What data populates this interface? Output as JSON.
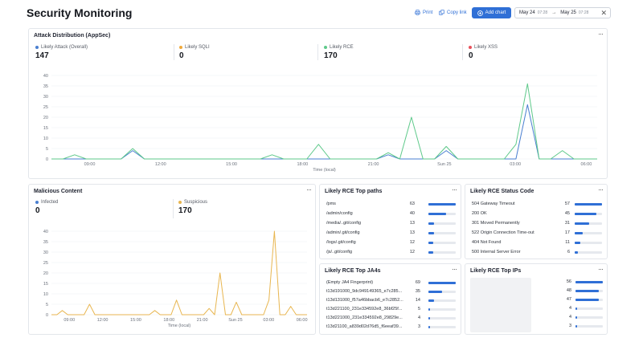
{
  "header": {
    "title": "Security Monitoring",
    "print_label": "Print",
    "copy_link_label": "Copy link",
    "add_chart_label": "Add chart",
    "date_from": "May 24",
    "time_from": "07:28",
    "date_to": "May 25",
    "time_to": "07:28",
    "arrow": "→",
    "close": "✕"
  },
  "colors": {
    "accent": "#2f6fd6",
    "attack": "#4a7fd0",
    "sqli": "#f0a93b",
    "rce": "#5ec98a",
    "xss": "#e8505b",
    "infected": "#4a7fd0",
    "suspicious": "#e8b650"
  },
  "attack_panel": {
    "title": "Attack Distribution (AppSec)",
    "menu": "···",
    "metrics": [
      {
        "label": "Likely Attack (Overall)",
        "value": "147",
        "color": "#4a7fd0"
      },
      {
        "label": "Likely SQLI",
        "value": "0",
        "color": "#f0a93b"
      },
      {
        "label": "Likely RCE",
        "value": "170",
        "color": "#5ec98a"
      },
      {
        "label": "Likely XSS",
        "value": "0",
        "color": "#e8505b"
      }
    ]
  },
  "malicious_panel": {
    "title": "Malicious Content",
    "menu": "···",
    "metrics": [
      {
        "label": "Infected",
        "value": "0",
        "color": "#4a7fd0"
      },
      {
        "label": "Suspicious",
        "value": "170",
        "color": "#e8b650"
      }
    ]
  },
  "chart_data": [
    {
      "type": "line",
      "panel": "Attack Distribution (AppSec)",
      "xlabel": "Time (local)",
      "ylabel": "",
      "ylim": [
        0,
        40
      ],
      "yticks": [
        "0",
        "5",
        "10",
        "15",
        "20",
        "25",
        "30",
        "35",
        "40"
      ],
      "xticks": [
        "09:00",
        "12:00",
        "15:00",
        "18:00",
        "21:00",
        "Sun 25",
        "03:00",
        "06:00"
      ],
      "x": [
        0,
        1,
        2,
        3,
        4,
        5,
        6,
        7,
        8,
        9,
        10,
        11,
        12,
        13,
        14,
        15,
        16,
        17,
        18,
        19,
        20,
        21,
        22,
        23,
        24,
        25,
        26,
        27,
        28,
        29,
        30,
        31,
        32,
        33,
        34,
        35,
        36,
        37,
        38,
        39,
        40,
        41,
        42,
        43,
        44,
        45,
        46,
        47
      ],
      "series": [
        {
          "name": "Likely Attack (Overall)",
          "color": "#4a7fd0",
          "values": [
            0,
            0,
            0,
            0,
            0,
            0,
            0,
            4,
            0,
            0,
            0,
            0,
            0,
            0,
            0,
            0,
            0,
            0,
            0,
            0,
            0,
            0,
            0,
            0,
            0,
            0,
            0,
            0,
            0,
            2,
            0,
            0,
            0,
            0,
            4,
            0,
            0,
            0,
            0,
            0,
            0,
            26,
            0,
            0,
            0,
            0,
            0,
            0
          ]
        },
        {
          "name": "Likely RCE",
          "color": "#5ec98a",
          "values": [
            0,
            0,
            2,
            0,
            0,
            0,
            0,
            5,
            0,
            0,
            0,
            0,
            0,
            0,
            0,
            0,
            0,
            0,
            0,
            2,
            0,
            0,
            0,
            7,
            0,
            0,
            0,
            0,
            0,
            3,
            0,
            20,
            0,
            0,
            6,
            0,
            0,
            0,
            0,
            0,
            7,
            36,
            0,
            0,
            4,
            0,
            0,
            0
          ]
        }
      ]
    },
    {
      "type": "line",
      "panel": "Malicious Content",
      "xlabel": "Time (local)",
      "ylabel": "",
      "ylim": [
        0,
        40
      ],
      "yticks": [
        "0",
        "5",
        "10",
        "15",
        "20",
        "25",
        "30",
        "35",
        "40"
      ],
      "xticks": [
        "09:00",
        "12:00",
        "15:00",
        "18:00",
        "21:00",
        "Sun 25",
        "03:00",
        "06:00"
      ],
      "x": [
        0,
        1,
        2,
        3,
        4,
        5,
        6,
        7,
        8,
        9,
        10,
        11,
        12,
        13,
        14,
        15,
        16,
        17,
        18,
        19,
        20,
        21,
        22,
        23,
        24,
        25,
        26,
        27,
        28,
        29,
        30,
        31,
        32,
        33,
        34,
        35,
        36,
        37,
        38,
        39,
        40,
        41,
        42,
        43,
        44,
        45,
        46,
        47
      ],
      "series": [
        {
          "name": "Suspicious",
          "color": "#e8b650",
          "values": [
            0,
            0,
            2,
            0,
            0,
            0,
            0,
            5,
            0,
            0,
            0,
            0,
            0,
            0,
            0,
            0,
            0,
            0,
            0,
            2,
            0,
            0,
            0,
            7,
            0,
            0,
            0,
            0,
            0,
            3,
            0,
            20,
            0,
            0,
            6,
            0,
            0,
            0,
            0,
            0,
            7,
            40,
            0,
            0,
            4,
            0,
            0,
            0
          ]
        }
      ]
    }
  ],
  "top_paths": {
    "title": "Likely RCE Top paths",
    "menu": "···",
    "max": 63,
    "rows": [
      {
        "key": "/pms",
        "value": 63
      },
      {
        "key": "/admin/config",
        "value": 40
      },
      {
        "key": "/media/..git/config",
        "value": 13
      },
      {
        "key": "/admin/.git/config",
        "value": 13
      },
      {
        "key": "/logs/.git/config",
        "value": 12
      },
      {
        "key": "/js/..git/config",
        "value": 12
      }
    ]
  },
  "status_codes": {
    "title": "Likely RCE Status Code",
    "menu": "···",
    "max": 57,
    "rows": [
      {
        "key": "504 Gateway Timeout",
        "value": 57
      },
      {
        "key": "200 OK",
        "value": 45
      },
      {
        "key": "301 Moved Permanently",
        "value": 31
      },
      {
        "key": "522 Origin Connection Time-out",
        "value": 17
      },
      {
        "key": "404 Not Found",
        "value": 11
      },
      {
        "key": "500 Internal Server Error",
        "value": 6
      }
    ]
  },
  "ja4": {
    "title": "Likely RCE Top JA4s",
    "menu": "···",
    "max": 69,
    "rows": [
      {
        "key": "(Empty JA4 Fingerprint)",
        "value": 69
      },
      {
        "key": "t13d191000_9dc949149365_e7c285...",
        "value": 35
      },
      {
        "key": "t13d131000_f57a46bbacb6_e7c2852...",
        "value": 14
      },
      {
        "key": "t13d221100_231e334592e8_36bf25f...",
        "value": 5
      },
      {
        "key": "t13d221000_231e334592e8_29829e...",
        "value": 4
      },
      {
        "key": "t13d21100_a839d02d76d5_f6eeaf39...",
        "value": 3
      }
    ]
  },
  "top_ips": {
    "title": "Likely RCE Top IPs",
    "menu": "···",
    "max": 56,
    "rows": [
      {
        "key": "",
        "value": 56
      },
      {
        "key": "",
        "value": 48
      },
      {
        "key": "",
        "value": 47
      },
      {
        "key": "",
        "value": 4
      },
      {
        "key": "",
        "value": 4
      },
      {
        "key": "",
        "value": 3
      }
    ]
  }
}
